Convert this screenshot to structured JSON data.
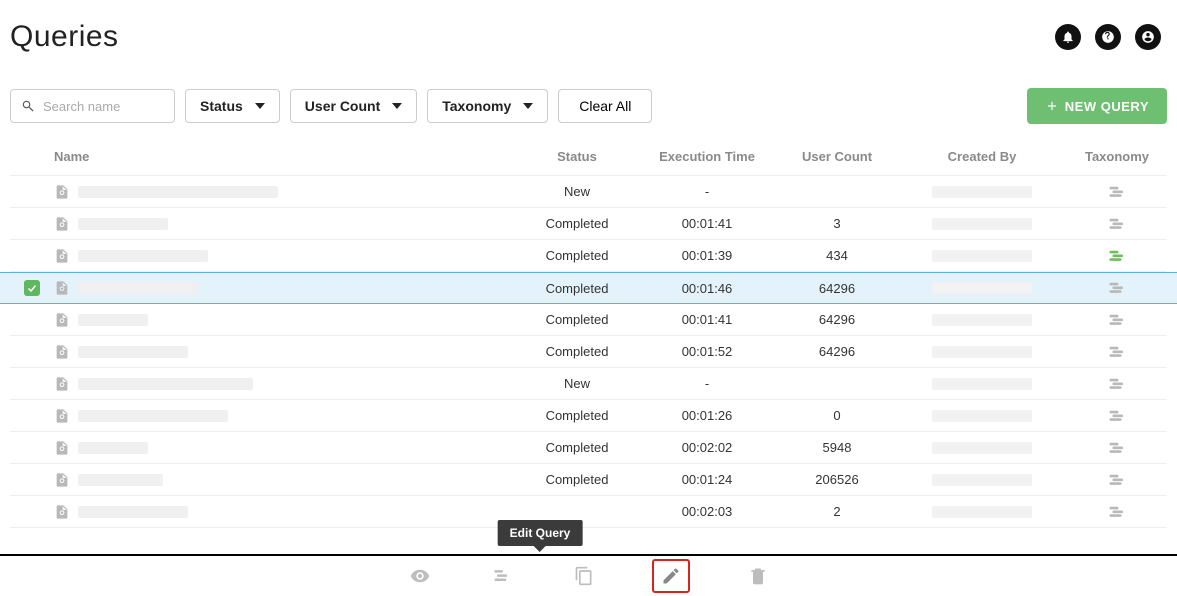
{
  "header": {
    "title": "Queries"
  },
  "toolbar": {
    "search_placeholder": "Search name",
    "filter_status": "Status",
    "filter_user_count": "User Count",
    "filter_taxonomy": "Taxonomy",
    "clear_all": "Clear All",
    "new_query": "NEW QUERY"
  },
  "columns": {
    "name": "Name",
    "status": "Status",
    "exec": "Execution Time",
    "user": "User Count",
    "created": "Created By",
    "tax": "Taxonomy"
  },
  "rows": [
    {
      "selected": false,
      "name_width": 200,
      "status": "New",
      "exec": "-",
      "user": "",
      "tax_green": false
    },
    {
      "selected": false,
      "name_width": 90,
      "status": "Completed",
      "exec": "00:01:41",
      "user": "3",
      "tax_green": false
    },
    {
      "selected": false,
      "name_width": 130,
      "status": "Completed",
      "exec": "00:01:39",
      "user": "434",
      "tax_green": true
    },
    {
      "selected": true,
      "name_width": 120,
      "status": "Completed",
      "exec": "00:01:46",
      "user": "64296",
      "tax_green": false
    },
    {
      "selected": false,
      "name_width": 70,
      "status": "Completed",
      "exec": "00:01:41",
      "user": "64296",
      "tax_green": false
    },
    {
      "selected": false,
      "name_width": 110,
      "status": "Completed",
      "exec": "00:01:52",
      "user": "64296",
      "tax_green": false
    },
    {
      "selected": false,
      "name_width": 175,
      "status": "New",
      "exec": "-",
      "user": "",
      "tax_green": false
    },
    {
      "selected": false,
      "name_width": 150,
      "status": "Completed",
      "exec": "00:01:26",
      "user": "0",
      "tax_green": false
    },
    {
      "selected": false,
      "name_width": 70,
      "status": "Completed",
      "exec": "00:02:02",
      "user": "5948",
      "tax_green": false
    },
    {
      "selected": false,
      "name_width": 85,
      "status": "Completed",
      "exec": "00:01:24",
      "user": "206526",
      "tax_green": false
    },
    {
      "selected": false,
      "name_width": 110,
      "status": "",
      "exec": "00:02:03",
      "user": "2",
      "tax_green": false
    }
  ],
  "tooltip": {
    "edit": "Edit Query"
  }
}
